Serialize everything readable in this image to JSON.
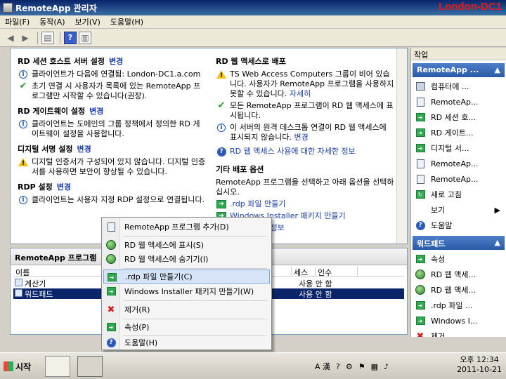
{
  "window": {
    "title": "RemoteApp 관리자",
    "host_label": "London-DC1"
  },
  "menu": [
    "파일(F)",
    "동작(A)",
    "보기(V)",
    "도움말(H)"
  ],
  "main": {
    "left": {
      "rd_session": {
        "heading": "RD 세션 호스트 서버 설정",
        "link": "변경",
        "items": [
          {
            "icon": "info-icon",
            "text": "클라이언트가 다음에 연결됨: London-DC1.a.com"
          },
          {
            "icon": "check-icon",
            "text": "초기 연결 시 사용자가 목록에 있는 RemoteApp 프로그램만 시작할 수 있습니다(권장)."
          }
        ]
      },
      "rd_gateway": {
        "heading": "RD 게이트웨이 설정",
        "link": "변경",
        "items": [
          {
            "icon": "info-icon",
            "text": "클라이언트는 도메인의 그룹 정책에서 정의한 RD 게이트웨이 설정을 사용합니다."
          }
        ]
      },
      "digital_sign": {
        "heading": "디지털 서명 설정",
        "link": "변경",
        "items": [
          {
            "icon": "warning-icon",
            "text": "디지털 인증서가 구성되어 있지 않습니다. 디지털 인증서를 사용하면 보안이 향상될 수 있습니다."
          }
        ]
      },
      "rdp": {
        "heading": "RDP 설정",
        "link": "변경",
        "items": [
          {
            "icon": "info-icon",
            "text": "클라이언트는 사용자 지정 RDP 설정으로 연결됩니다."
          }
        ]
      }
    },
    "right": {
      "web_access": {
        "heading": "RD 웹 액세스로 배포",
        "warn_text": "TS Web Access Computers 그룹이 비어 있습니다. 사용자가 RemoteApp 프로그램을 사용하지 못할 수 있습니다.",
        "warn_link": "자세히",
        "check_text": "모든 RemoteApp 프로그램이 RD 웹 액세스에 표시됩니다.",
        "info_text": "이 서버의 원격 데스크톱 연결이 RD 웹 액세스에 표시되지 않습니다.",
        "info_link": "변경",
        "help_link": "RD 웹 액세스 사용에 대한 자세한 정보"
      },
      "other": {
        "heading": "기타 배포 옵션",
        "text": "RemoteApp 프로그램을 선택하고 아래 옵션을 선택하십시오.",
        "links": [
          ".rdp 파일 만들기",
          "Windows Installer 패키지 만들기",
          "대한 자세한 정보"
        ]
      }
    }
  },
  "programs": {
    "header": "RemoteApp 프로그램",
    "columns": [
      "이름",
      "세스",
      "인수"
    ],
    "rows": [
      {
        "name": "계산기",
        "arg": "사용 안 함",
        "selected": false
      },
      {
        "name": "워드패드",
        "arg": "사용 안 함",
        "selected": true
      }
    ]
  },
  "actions": {
    "title": "작업",
    "group1": {
      "header": "RemoteApp ...",
      "items": [
        {
          "label": "컴퓨터에 ...",
          "icon": "computer-icon"
        },
        {
          "label": "RemoteAp...",
          "icon": "add-program-icon"
        },
        {
          "label": "RD 세션 호...",
          "icon": "arrow-icon"
        },
        {
          "label": "RD 게이트...",
          "icon": "arrow-icon"
        },
        {
          "label": "디지털 서...",
          "icon": "arrow-icon"
        },
        {
          "label": "RemoteAp...",
          "icon": "document-icon"
        },
        {
          "label": "RemoteAp...",
          "icon": "document-icon"
        },
        {
          "label": "새로 고침",
          "icon": "refresh-icon"
        },
        {
          "label": "보기",
          "icon": ""
        },
        {
          "label": "도움말",
          "icon": "help-icon"
        }
      ]
    },
    "group2": {
      "header": "워드패드",
      "items": [
        {
          "label": "속성",
          "icon": "arrow-icon"
        },
        {
          "label": "RD 웹 액세...",
          "icon": "globe-icon"
        },
        {
          "label": "RD 웹 액세...",
          "icon": "globe-icon"
        },
        {
          "label": ".rdp 파일 ...",
          "icon": "arrow-icon"
        },
        {
          "label": "Windows I...",
          "icon": "arrow-icon"
        },
        {
          "label": "제거",
          "icon": "delete-icon"
        }
      ]
    }
  },
  "context_menu": {
    "items": [
      {
        "label": "RemoteApp 프로그램 추가(D)",
        "icon": "add-program-icon",
        "highlight": false
      },
      {
        "label": "RD 웹 액세스에 표시(S)",
        "icon": "globe-icon",
        "highlight": false
      },
      {
        "label": "RD 웹 액세스에 숨기기(I)",
        "icon": "globe-icon",
        "highlight": false
      },
      {
        "label": ".rdp 파일 만들기(C)",
        "icon": "arrow-icon",
        "highlight": true
      },
      {
        "label": "Windows Installer 패키지 만들기(W)",
        "icon": "arrow-icon",
        "highlight": false
      },
      {
        "label": "제거(R)",
        "icon": "delete-icon",
        "highlight": false
      },
      {
        "label": "속성(P)",
        "icon": "arrow-icon",
        "highlight": false
      },
      {
        "label": "도움말(H)",
        "icon": "help-icon",
        "highlight": false
      }
    ]
  },
  "taskbar": {
    "start": "시작",
    "tray_lang": "A 漢",
    "time": "오후 12:34",
    "date": "2011-10-21"
  }
}
